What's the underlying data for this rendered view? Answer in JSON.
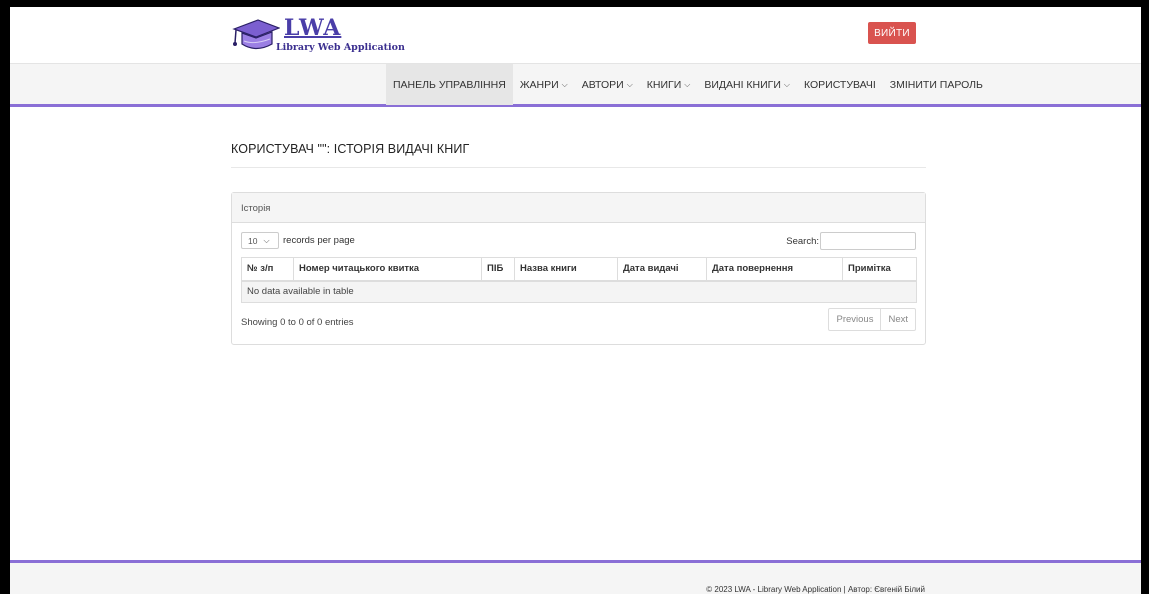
{
  "brand": {
    "title": "LWA",
    "subtitle": "Library Web Application"
  },
  "header": {
    "logout_label": "ВИЙТИ"
  },
  "nav": {
    "items": [
      {
        "label": "ПАНЕЛЬ УПРАВЛІННЯ",
        "dropdown": false,
        "active": true
      },
      {
        "label": "ЖАНРИ",
        "dropdown": true
      },
      {
        "label": "АВТОРИ",
        "dropdown": true
      },
      {
        "label": "КНИГИ",
        "dropdown": true
      },
      {
        "label": "ВИДАНІ КНИГИ",
        "dropdown": true
      },
      {
        "label": "КОРИСТУВАЧІ",
        "dropdown": false
      },
      {
        "label": "ЗМІНИТИ ПАРОЛЬ",
        "dropdown": false
      }
    ]
  },
  "page": {
    "title": "КОРИСТУВАЧ \"\": ІСТОРІЯ ВИДАЧІ КНИГ"
  },
  "panel": {
    "heading": "Історія",
    "length_value": "10",
    "length_suffix": "records per page",
    "search_label": "Search:",
    "search_value": "",
    "columns": [
      "№ з/п",
      "Номер читацького квитка",
      "ПІБ",
      "Назва книги",
      "Дата видачі",
      "Дата повернення",
      "Примітка"
    ],
    "empty_text": "No data available in table",
    "info": "Showing 0 to 0 of 0 entries",
    "prev_label": "Previous",
    "next_label": "Next"
  },
  "footer": {
    "text": "© 2023 LWA - Library Web Application | Автор: Євгеній Білий"
  },
  "colors": {
    "accent": "#8a6fd6",
    "logout": "#d9534f",
    "brand": "#4a3ea8"
  }
}
